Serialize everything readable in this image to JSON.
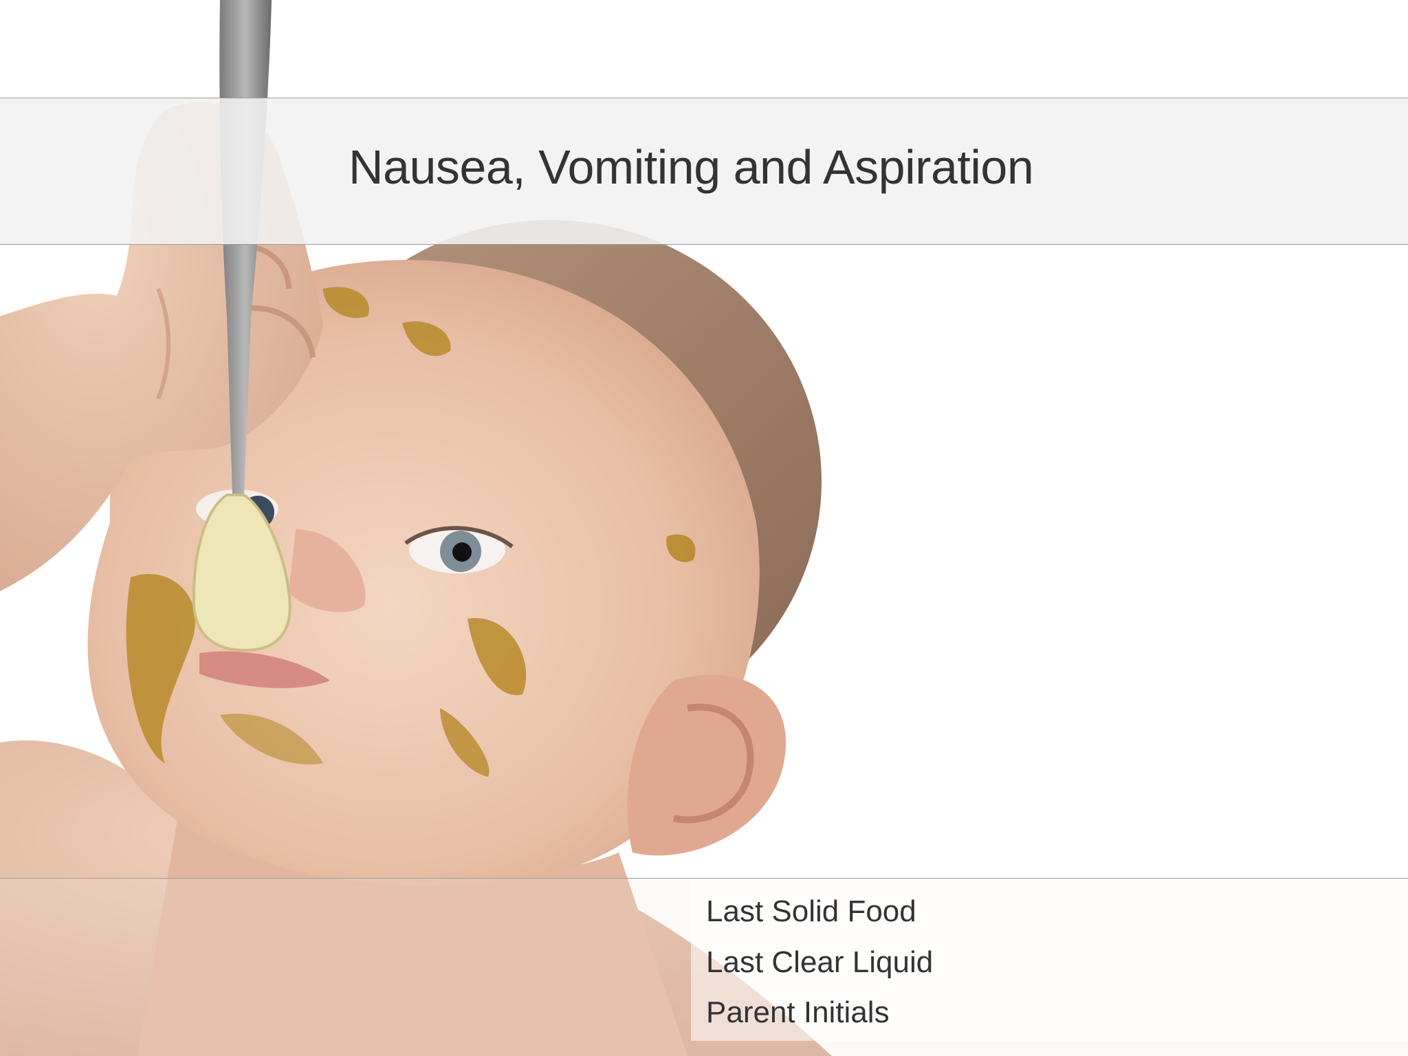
{
  "header": {
    "title": "Nausea, Vomiting and Aspiration"
  },
  "form": {
    "fields": [
      {
        "label": "Last Solid Food"
      },
      {
        "label": "Last Clear Liquid"
      },
      {
        "label": "Parent Initials"
      }
    ]
  },
  "photo": {
    "subject": "baby-eating-with-spoon"
  },
  "colors": {
    "title_band_bg": "#f1f1f1",
    "title_text": "#333333",
    "divider": "#9a9a9a",
    "page_bg": "#ffffff"
  }
}
